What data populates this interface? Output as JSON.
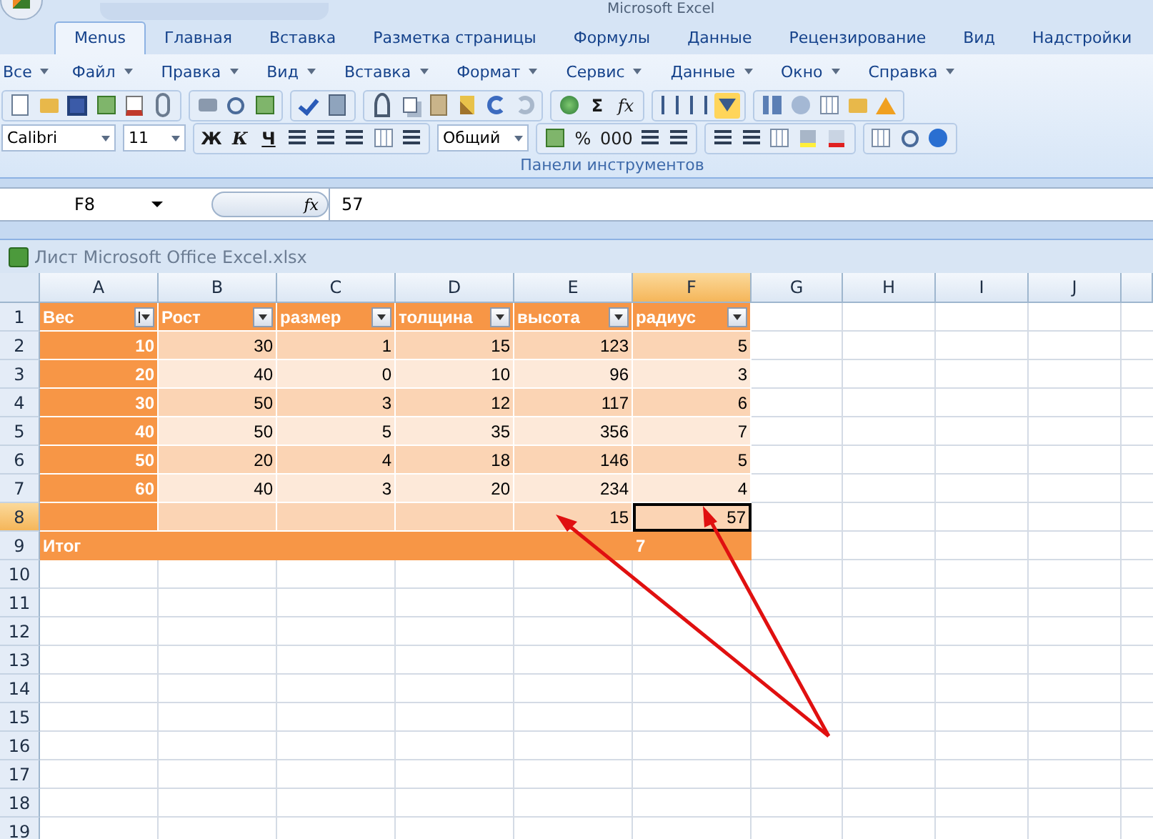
{
  "window": {
    "title": "Microsoft Excel"
  },
  "ribbon_tabs": [
    {
      "label": "Menus",
      "selected": true
    },
    {
      "label": "Главная",
      "selected": false
    },
    {
      "label": "Вставка",
      "selected": false
    },
    {
      "label": "Разметка страницы",
      "selected": false
    },
    {
      "label": "Формулы",
      "selected": false
    },
    {
      "label": "Данные",
      "selected": false
    },
    {
      "label": "Рецензирование",
      "selected": false
    },
    {
      "label": "Вид",
      "selected": false
    },
    {
      "label": "Надстройки",
      "selected": false
    }
  ],
  "menus": [
    "Все",
    "Файл",
    "Правка",
    "Вид",
    "Вставка",
    "Формат",
    "Сервис",
    "Данные",
    "Окно",
    "Справка"
  ],
  "toolbar": {
    "font": "Calibri",
    "size": "11",
    "bold": "Ж",
    "italic": "К",
    "underline": "Ч",
    "number_format": "Общий",
    "sum": "Σ",
    "function": "fx",
    "percent": "%",
    "thousands": "000",
    "group_label": "Панели инструментов"
  },
  "formula_bar": {
    "name_box": "F8",
    "fx": "fx",
    "value": "57"
  },
  "workbook": {
    "title": "Лист Microsoft Office Excel.xlsx"
  },
  "columns": [
    {
      "letter": "A",
      "selected": false
    },
    {
      "letter": "B",
      "selected": false
    },
    {
      "letter": "C",
      "selected": false
    },
    {
      "letter": "D",
      "selected": false
    },
    {
      "letter": "E",
      "selected": false
    },
    {
      "letter": "F",
      "selected": true
    },
    {
      "letter": "G",
      "selected": false
    },
    {
      "letter": "H",
      "selected": false
    },
    {
      "letter": "I",
      "selected": false
    },
    {
      "letter": "J",
      "selected": false
    }
  ],
  "rows": [
    {
      "number": "1",
      "kind": "header",
      "selected": false,
      "cells": [
        "Вес",
        "Рост",
        "размер",
        "толщина",
        "высота",
        "радиус"
      ],
      "sorted": [
        true,
        false,
        false,
        false,
        false,
        false
      ]
    },
    {
      "number": "2",
      "kind": "data",
      "selected": false,
      "cells": [
        "10",
        "30",
        "1",
        "15",
        "123",
        "5"
      ]
    },
    {
      "number": "3",
      "kind": "data",
      "selected": false,
      "cells": [
        "20",
        "40",
        "0",
        "10",
        "96",
        "3"
      ]
    },
    {
      "number": "4",
      "kind": "data",
      "selected": false,
      "cells": [
        "30",
        "50",
        "3",
        "12",
        "117",
        "6"
      ]
    },
    {
      "number": "5",
      "kind": "data",
      "selected": false,
      "cells": [
        "40",
        "50",
        "5",
        "35",
        "356",
        "7"
      ]
    },
    {
      "number": "6",
      "kind": "data",
      "selected": false,
      "cells": [
        "50",
        "20",
        "4",
        "18",
        "146",
        "5"
      ]
    },
    {
      "number": "7",
      "kind": "data",
      "selected": false,
      "cells": [
        "60",
        "40",
        "3",
        "20",
        "234",
        "4"
      ]
    },
    {
      "number": "8",
      "kind": "data",
      "selected": true,
      "cells": [
        "",
        "",
        "",
        "",
        "15",
        "57"
      ]
    },
    {
      "number": "9",
      "kind": "total",
      "selected": false,
      "cells": [
        "Итог",
        "",
        "",
        "",
        "",
        "7"
      ]
    },
    {
      "number": "10",
      "kind": "empty",
      "selected": false
    },
    {
      "number": "11",
      "kind": "empty",
      "selected": false
    },
    {
      "number": "12",
      "kind": "empty",
      "selected": false
    },
    {
      "number": "13",
      "kind": "empty",
      "selected": false
    },
    {
      "number": "14",
      "kind": "empty",
      "selected": false
    },
    {
      "number": "15",
      "kind": "empty",
      "selected": false
    },
    {
      "number": "16",
      "kind": "empty",
      "selected": false
    },
    {
      "number": "17",
      "kind": "empty",
      "selected": false
    },
    {
      "number": "18",
      "kind": "empty",
      "selected": false
    },
    {
      "number": "19",
      "kind": "empty",
      "selected": false
    }
  ]
}
